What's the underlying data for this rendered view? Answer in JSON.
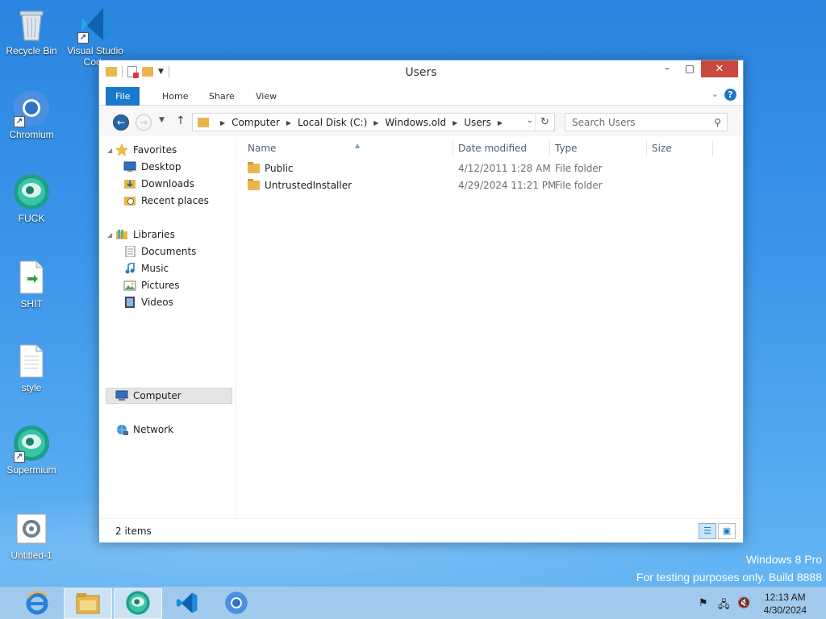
{
  "desktop": {
    "icons": [
      {
        "label": "Recycle Bin",
        "icon": "recycle-bin-icon"
      },
      {
        "label": "Visual Studio Code",
        "icon": "vscode-icon"
      },
      {
        "label": "Chromium",
        "icon": "chromium-icon"
      },
      {
        "label": "FUCK",
        "icon": "supermium-icon"
      },
      {
        "label": "SHIT",
        "icon": "document-shortcut-icon"
      },
      {
        "label": "style",
        "icon": "text-file-icon"
      },
      {
        "label": "Supermium",
        "icon": "supermium-icon"
      },
      {
        "label": "Untitled-1",
        "icon": "settings-file-icon"
      }
    ],
    "watermark": {
      "line1": "Windows 8 Pro",
      "line2": "For testing purposes only. Build 8888"
    }
  },
  "window": {
    "title": "Users",
    "controls": {
      "minimize": "–",
      "maximize": "□",
      "close": "✕"
    },
    "ribbon_tabs": [
      "File",
      "Home",
      "Share",
      "View"
    ],
    "address": {
      "crumbs": [
        "Computer",
        "Local Disk (C:)",
        "Windows.old",
        "Users"
      ]
    },
    "search": {
      "placeholder": "Search Users"
    },
    "nav_pane": {
      "favorites": {
        "label": "Favorites",
        "items": [
          "Desktop",
          "Downloads",
          "Recent places"
        ]
      },
      "libraries": {
        "label": "Libraries",
        "items": [
          "Documents",
          "Music",
          "Pictures",
          "Videos"
        ]
      },
      "computer": "Computer",
      "network": "Network"
    },
    "columns": [
      "Name",
      "Date modified",
      "Type",
      "Size"
    ],
    "files": [
      {
        "name": "Public",
        "date": "4/12/2011 1:28 AM",
        "type": "File folder",
        "size": ""
      },
      {
        "name": "UntrustedInstaller",
        "date": "4/29/2024 11:21 PM",
        "type": "File folder",
        "size": ""
      }
    ],
    "status": "2 items"
  },
  "taskbar": {
    "pinned": [
      "internet-explorer-icon",
      "file-explorer-icon",
      "supermium-icon",
      "vscode-icon",
      "chromium-icon"
    ],
    "clock": {
      "time": "12:13 AM",
      "date": "4/30/2024"
    }
  },
  "colors": {
    "accent": "#1979ca",
    "close_button": "#c9493f",
    "folder": "#e8b64a",
    "desktop_top": "#2a85e0"
  }
}
